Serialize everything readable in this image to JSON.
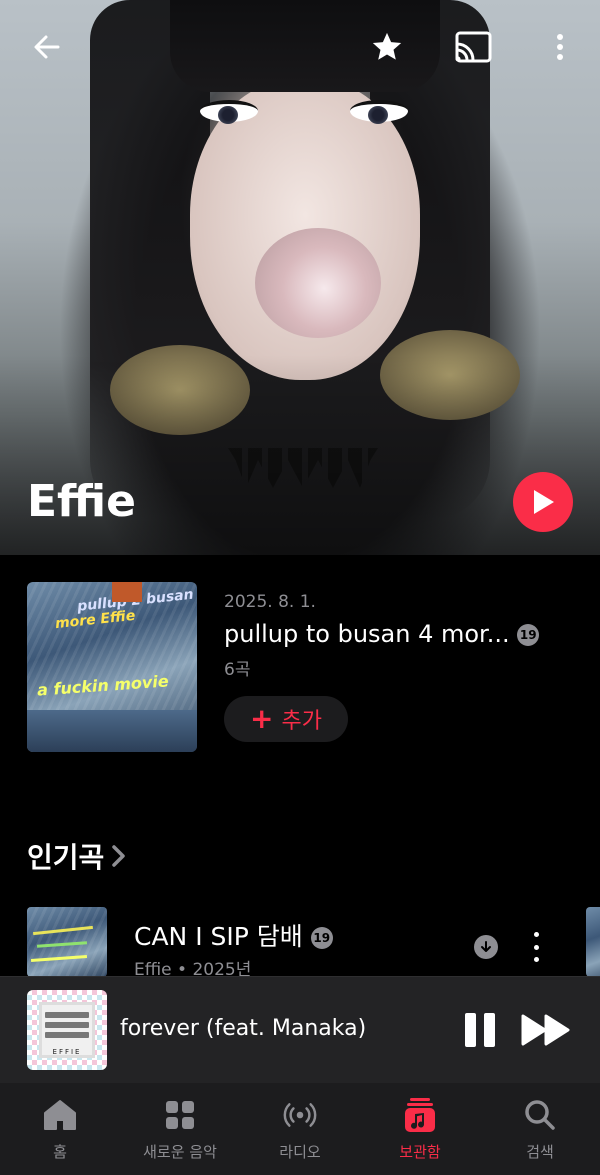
{
  "header": {
    "artist_name": "Effie",
    "icons": [
      "back-arrow-icon",
      "star-icon",
      "cast-icon",
      "more-vertical-icon"
    ]
  },
  "latest_release": {
    "date": "2025. 8. 1.",
    "title": "pullup to busan 4 mor...",
    "explicit_badge": "19",
    "track_count": "6곡",
    "add_label": "추가",
    "artwork_text": [
      "pullup 2 busan 4",
      "more Effie",
      "a fuckin movie"
    ]
  },
  "top_songs": {
    "section_title": "인기곡",
    "items": [
      {
        "title": "CAN I SIP 담배",
        "explicit_badge": "19",
        "artist": "Effie",
        "separator": "•",
        "year": "2025년"
      }
    ]
  },
  "mini_player": {
    "title": "forever (feat. Manaka)",
    "art_label": "EFFIE"
  },
  "tabbar": {
    "tabs": [
      {
        "label": "홈",
        "icon": "home-icon",
        "active": false
      },
      {
        "label": "새로운 음악",
        "icon": "grid-icon",
        "active": false
      },
      {
        "label": "라디오",
        "icon": "radio-icon",
        "active": false
      },
      {
        "label": "보관함",
        "icon": "library-icon",
        "active": true
      },
      {
        "label": "검색",
        "icon": "search-icon",
        "active": false
      }
    ]
  },
  "colors": {
    "accent": "#fa2d48",
    "secondary_text": "#8e8e93",
    "background": "#000000",
    "mini_player_bg": "#232325",
    "tabbar_bg": "#1c1c1e"
  }
}
